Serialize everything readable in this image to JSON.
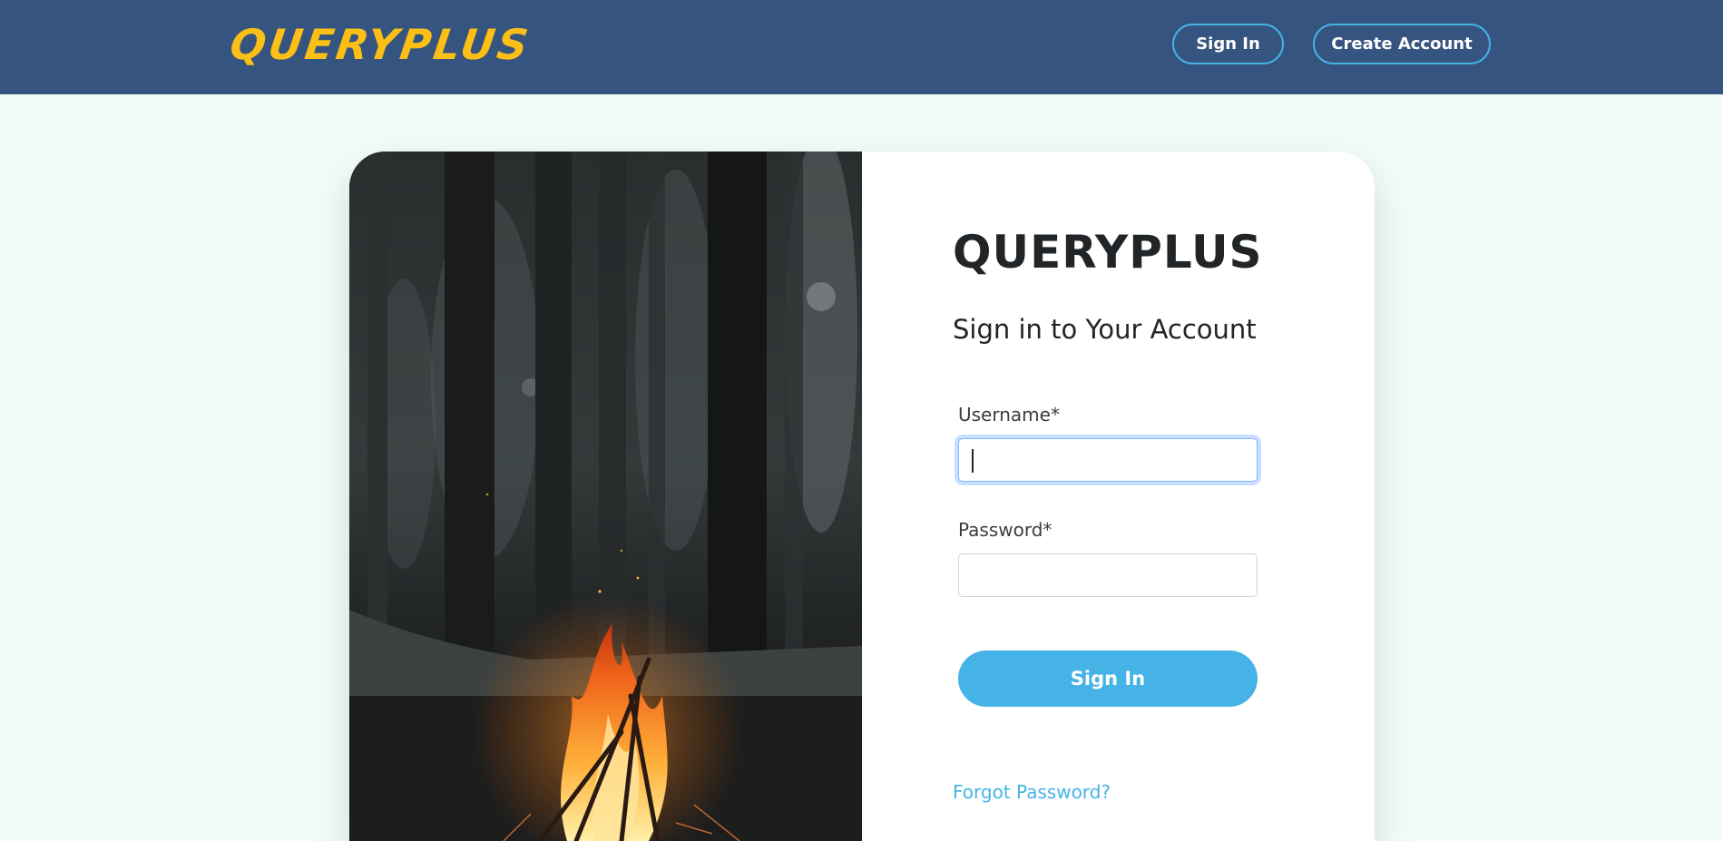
{
  "header": {
    "brand": "QUERYPLUS",
    "sign_in_label": "Sign In",
    "create_account_label": "Create Account"
  },
  "login": {
    "brand": "QUERYPLUS",
    "heading": "Sign in to Your Account",
    "username_label": "Username*",
    "username_value": "",
    "password_label": "Password*",
    "password_value": "",
    "submit_label": "Sign In",
    "forgot_label": "Forgot Password?"
  },
  "colors": {
    "navbar": "#365480",
    "brand": "#fbbf16",
    "accent": "#45b3e6",
    "page_background": "#f3fdf8"
  }
}
